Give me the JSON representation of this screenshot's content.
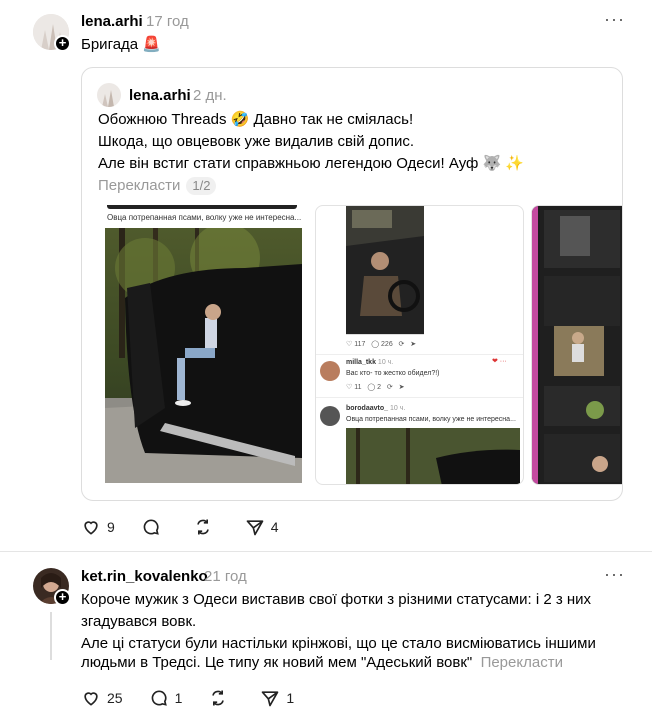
{
  "post1": {
    "username": "lena.arhi",
    "time": "17 год",
    "text": "Бригада 🚨",
    "quote": {
      "username": "lena.arhi",
      "time": "2 дн.",
      "lines": [
        "Обожнюю Threads 🤣 Давно так не сміялась!",
        "Шкода, що овцевовк уже видалив свій допис.",
        "Але він встиг стати справжньою легендою Одеси! Ауф 🐺 ✨"
      ],
      "translate_label": "Перекласти",
      "pager": "1/2"
    },
    "images": {
      "img1_caption": "Овца потрепанная псами, волку уже не интересна...",
      "img2": {
        "likes": "117",
        "comments": "226",
        "reply1_user": "milla_tkk",
        "reply1_time": "10 ч.",
        "reply1_text": "Вас кто- то жестко обидел?!)",
        "reply1_likes": "11",
        "reply1_comments": "2",
        "reply2_user": "borodaavto_",
        "reply2_time": "10 ч.",
        "reply2_text": "Овца потрепанная псами, волку уже не интересна..."
      }
    },
    "likes": "9",
    "shares": "4"
  },
  "post2": {
    "username": "ket.rin_kovalenko",
    "time": "21 год",
    "lines": [
      "Короче мужик з Одеси виставив свої фотки з різними статусами: і 2 з них",
      "згадувався вовк.",
      "Але ці статуси були настільки крінжові, що це стало висміюватись іншими",
      "людьми в Тредсі. Це типу як новий мем \"Адеський вовк\""
    ],
    "translate_label": "Перекласти",
    "likes": "25",
    "comments": "1",
    "shares": "1"
  }
}
